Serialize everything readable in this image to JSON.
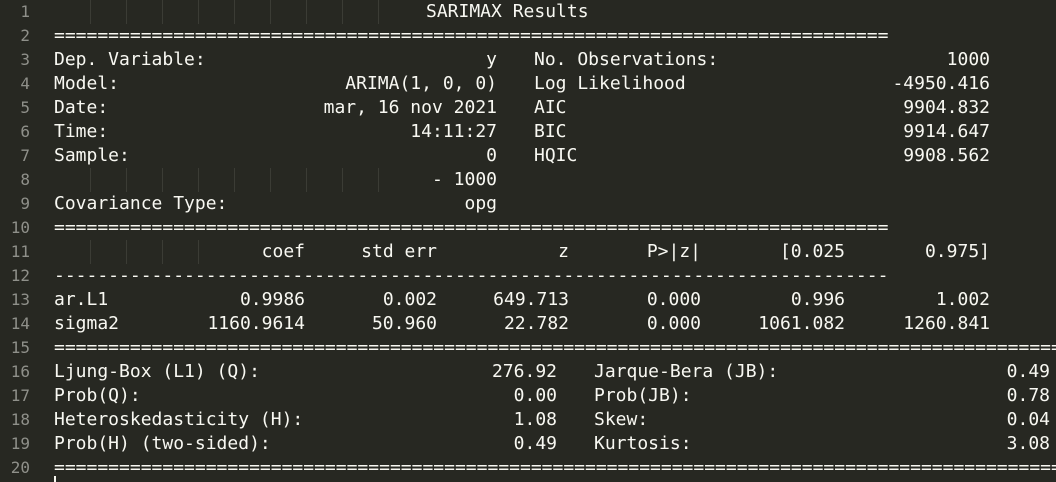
{
  "line_numbers": [
    "1",
    "2",
    "3",
    "4",
    "5",
    "6",
    "7",
    "8",
    "9",
    "10",
    "11",
    "12",
    "13",
    "14",
    "15",
    "16",
    "17",
    "18",
    "19",
    "20"
  ],
  "title": "SARIMAX Results",
  "rule_eq_short": "=============================================================================",
  "rule_eq_long": "==============================================================================================",
  "rule_dash": "-----------------------------------------------------------------------------",
  "model_info": {
    "dep_variable_label": "Dep. Variable:",
    "dep_variable_value": "y",
    "model_label": "Model:",
    "model_value": "ARIMA(1, 0, 0)",
    "date_label": "Date:",
    "date_value": "mar, 16 nov 2021",
    "time_label": "Time:",
    "time_value": "14:11:27",
    "sample_label": "Sample:",
    "sample_value": "0",
    "sample_end": "- 1000",
    "cov_type_label": "Covariance Type:",
    "cov_type_value": "opg",
    "nobs_label": "No. Observations:",
    "nobs_value": "1000",
    "llf_label": "Log Likelihood",
    "llf_value": "-4950.416",
    "aic_label": "AIC",
    "aic_value": "9904.832",
    "bic_label": "BIC",
    "bic_value": "9914.647",
    "hqic_label": "HQIC",
    "hqic_value": "9908.562"
  },
  "coef_table": {
    "headers": [
      "coef",
      "std err",
      "z",
      "P>|z|",
      "[0.025",
      "0.975]"
    ],
    "rows": [
      {
        "name": "ar.L1",
        "values": [
          "0.9986",
          "0.002",
          "649.713",
          "0.000",
          "0.996",
          "1.002"
        ]
      },
      {
        "name": "sigma2",
        "values": [
          "1160.9614",
          "50.960",
          "22.782",
          "0.000",
          "1061.082",
          "1260.841"
        ]
      }
    ]
  },
  "diagnostics": {
    "left": [
      {
        "label": "Ljung-Box (L1) (Q):",
        "value": "276.92"
      },
      {
        "label": "Prob(Q):",
        "value": "0.00"
      },
      {
        "label": "Heteroskedasticity (H):",
        "value": "1.08"
      },
      {
        "label": "Prob(H) (two-sided):",
        "value": "0.49"
      }
    ],
    "right": [
      {
        "label": "Jarque-Bera (JB):",
        "value": "0.49"
      },
      {
        "label": "Prob(JB):",
        "value": "0.78"
      },
      {
        "label": "Skew:",
        "value": "0.04"
      },
      {
        "label": "Kurtosis:",
        "value": "3.08"
      }
    ]
  },
  "colors": {
    "background": "#272822",
    "text": "#f8f8f2",
    "line_numbers": "#8f908a",
    "indent_guides": "#3b3c35"
  }
}
